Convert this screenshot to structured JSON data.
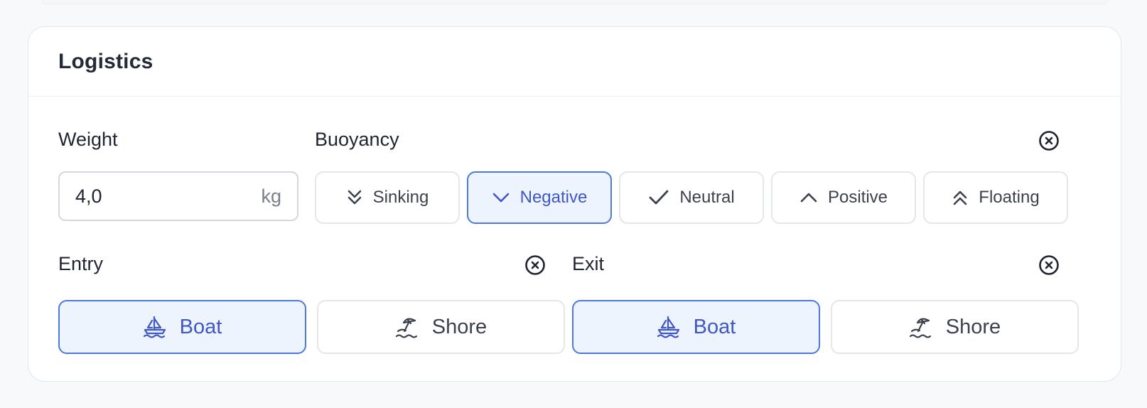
{
  "card": {
    "title": "Logistics"
  },
  "weight": {
    "label": "Weight",
    "value": "4,0",
    "unit": "kg"
  },
  "buoyancy": {
    "label": "Buoyancy",
    "selected": "Negative",
    "options": [
      {
        "label": "Sinking",
        "icon": "double-chevron-down-icon"
      },
      {
        "label": "Negative",
        "icon": "chevron-down-icon"
      },
      {
        "label": "Neutral",
        "icon": "check-icon"
      },
      {
        "label": "Positive",
        "icon": "chevron-up-icon"
      },
      {
        "label": "Floating",
        "icon": "double-chevron-up-icon"
      }
    ]
  },
  "entry": {
    "label": "Entry",
    "selected": "Boat",
    "options": [
      {
        "label": "Boat",
        "icon": "sailboat-icon"
      },
      {
        "label": "Shore",
        "icon": "beach-umbrella-icon"
      }
    ]
  },
  "exit": {
    "label": "Exit",
    "selected": "Boat",
    "options": [
      {
        "label": "Boat",
        "icon": "sailboat-icon"
      },
      {
        "label": "Shore",
        "icon": "beach-umbrella-icon"
      }
    ]
  },
  "colors": {
    "accent": "#3f57c8",
    "accent_border": "#4e78db",
    "selected_bg": "#eef4fe",
    "border": "#e3e6ea"
  }
}
